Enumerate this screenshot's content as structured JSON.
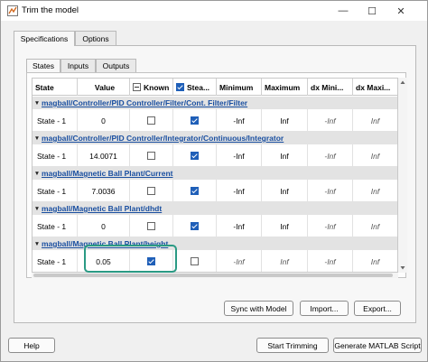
{
  "window": {
    "title": "Trim the model",
    "minimize": "—",
    "maximize": "☐",
    "close": "✕"
  },
  "outer_tabs": [
    {
      "label": "Specifications",
      "active": true
    },
    {
      "label": "Options",
      "active": false
    }
  ],
  "inner_tabs": [
    {
      "label": "States",
      "active": true
    },
    {
      "label": "Inputs",
      "active": false
    },
    {
      "label": "Outputs",
      "active": false
    }
  ],
  "table": {
    "columns": [
      "State",
      "Value",
      "Known",
      "Stea...",
      "Minimum",
      "Maximum",
      "dx Mini...",
      "dx Maxi..."
    ],
    "groups": [
      {
        "path": "magball/Controller/PID Controller/Filter/Cont. Filter/Filter",
        "row": {
          "state": "State - 1",
          "value": "0",
          "known": false,
          "steady": true,
          "minimum": "-Inf",
          "maximum": "Inf",
          "dx_min": "-Inf",
          "dx_max": "Inf"
        }
      },
      {
        "path": "magball/Controller/PID Controller/Integrator/Continuous/Integrator",
        "row": {
          "state": "State - 1",
          "value": "14.0071",
          "known": false,
          "steady": true,
          "minimum": "-Inf",
          "maximum": "Inf",
          "dx_min": "-Inf",
          "dx_max": "Inf"
        }
      },
      {
        "path": "magball/Magnetic Ball Plant/Current",
        "row": {
          "state": "State - 1",
          "value": "7.0036",
          "known": false,
          "steady": true,
          "minimum": "-Inf",
          "maximum": "Inf",
          "dx_min": "-Inf",
          "dx_max": "Inf"
        }
      },
      {
        "path": "magball/Magnetic Ball Plant/dhdt",
        "row": {
          "state": "State - 1",
          "value": "0",
          "known": false,
          "steady": true,
          "minimum": "-Inf",
          "maximum": "Inf",
          "dx_min": "-Inf",
          "dx_max": "Inf"
        }
      },
      {
        "path": "magball/Magnetic Ball Plant/height",
        "row": {
          "state": "State - 1",
          "value": "0.05",
          "known": true,
          "steady": false,
          "minimum": "-Inf",
          "maximum": "Inf",
          "dx_min": "-Inf",
          "dx_max": "Inf"
        }
      }
    ]
  },
  "panel_buttons": {
    "sync": "Sync with Model",
    "import": "Import...",
    "export": "Export..."
  },
  "footer_buttons": {
    "help": "Help",
    "start": "Start Trimming",
    "generate": "Generate MATLAB Script"
  },
  "colors": {
    "link": "#1a4fa0",
    "checkbox_checked": "#1f5fb8",
    "highlight": "#2a9a84"
  }
}
